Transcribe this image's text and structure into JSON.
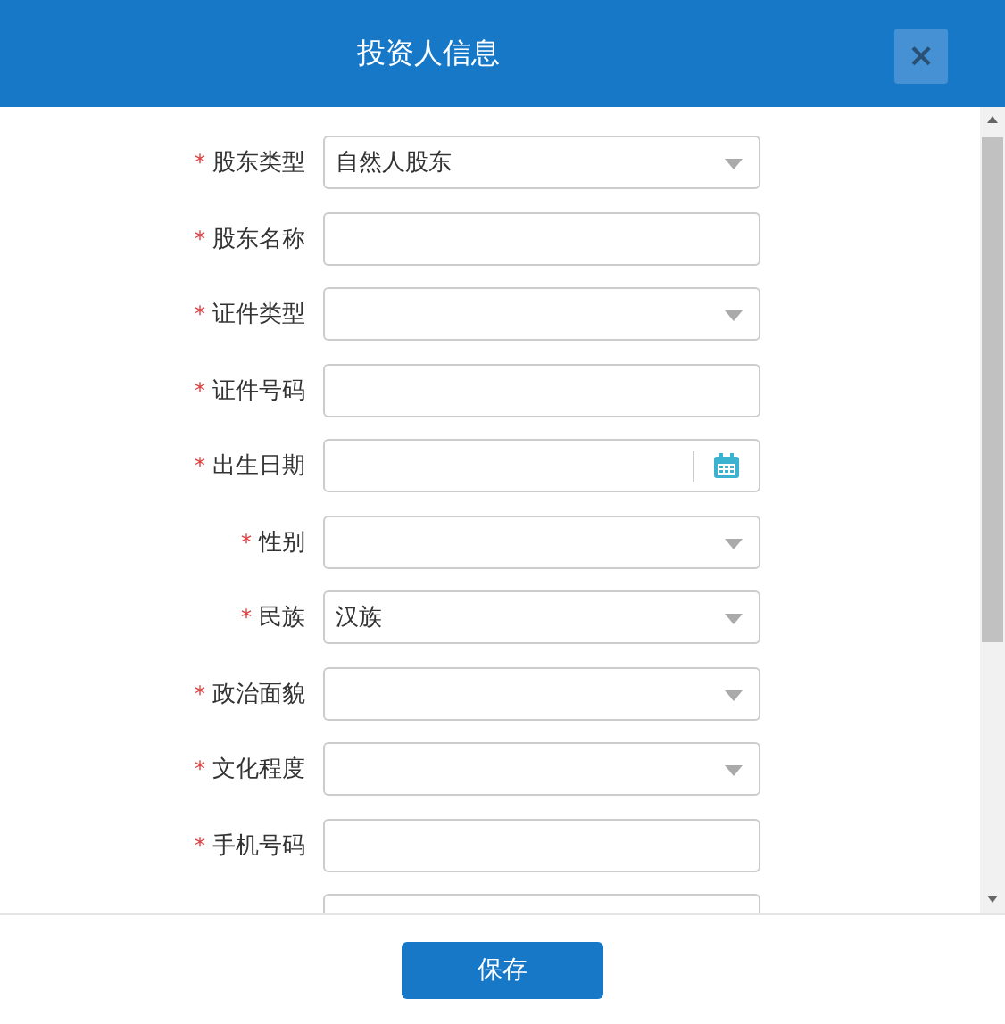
{
  "dialog": {
    "title": "投资人信息",
    "close": "×"
  },
  "fields": [
    {
      "label": "股东类型",
      "required": "*",
      "kind": "select",
      "value": "自然人股东"
    },
    {
      "label": "股东名称",
      "required": "*",
      "kind": "text"
    },
    {
      "label": "证件类型",
      "required": "*",
      "kind": "select"
    },
    {
      "label": "证件号码",
      "required": "*",
      "kind": "text"
    },
    {
      "label": "出生日期",
      "required": "*",
      "kind": "date"
    },
    {
      "label": "性别",
      "required": "*",
      "kind": "select"
    },
    {
      "label": "民族",
      "required": "*",
      "kind": "select",
      "value": "汉族"
    },
    {
      "label": "政治面貌",
      "required": "*",
      "kind": "select"
    },
    {
      "label": "文化程度",
      "required": "*",
      "kind": "select"
    },
    {
      "label": "手机号码",
      "required": "*",
      "kind": "text"
    },
    {
      "kind": "text"
    }
  ],
  "footer": {
    "save": "保存"
  }
}
